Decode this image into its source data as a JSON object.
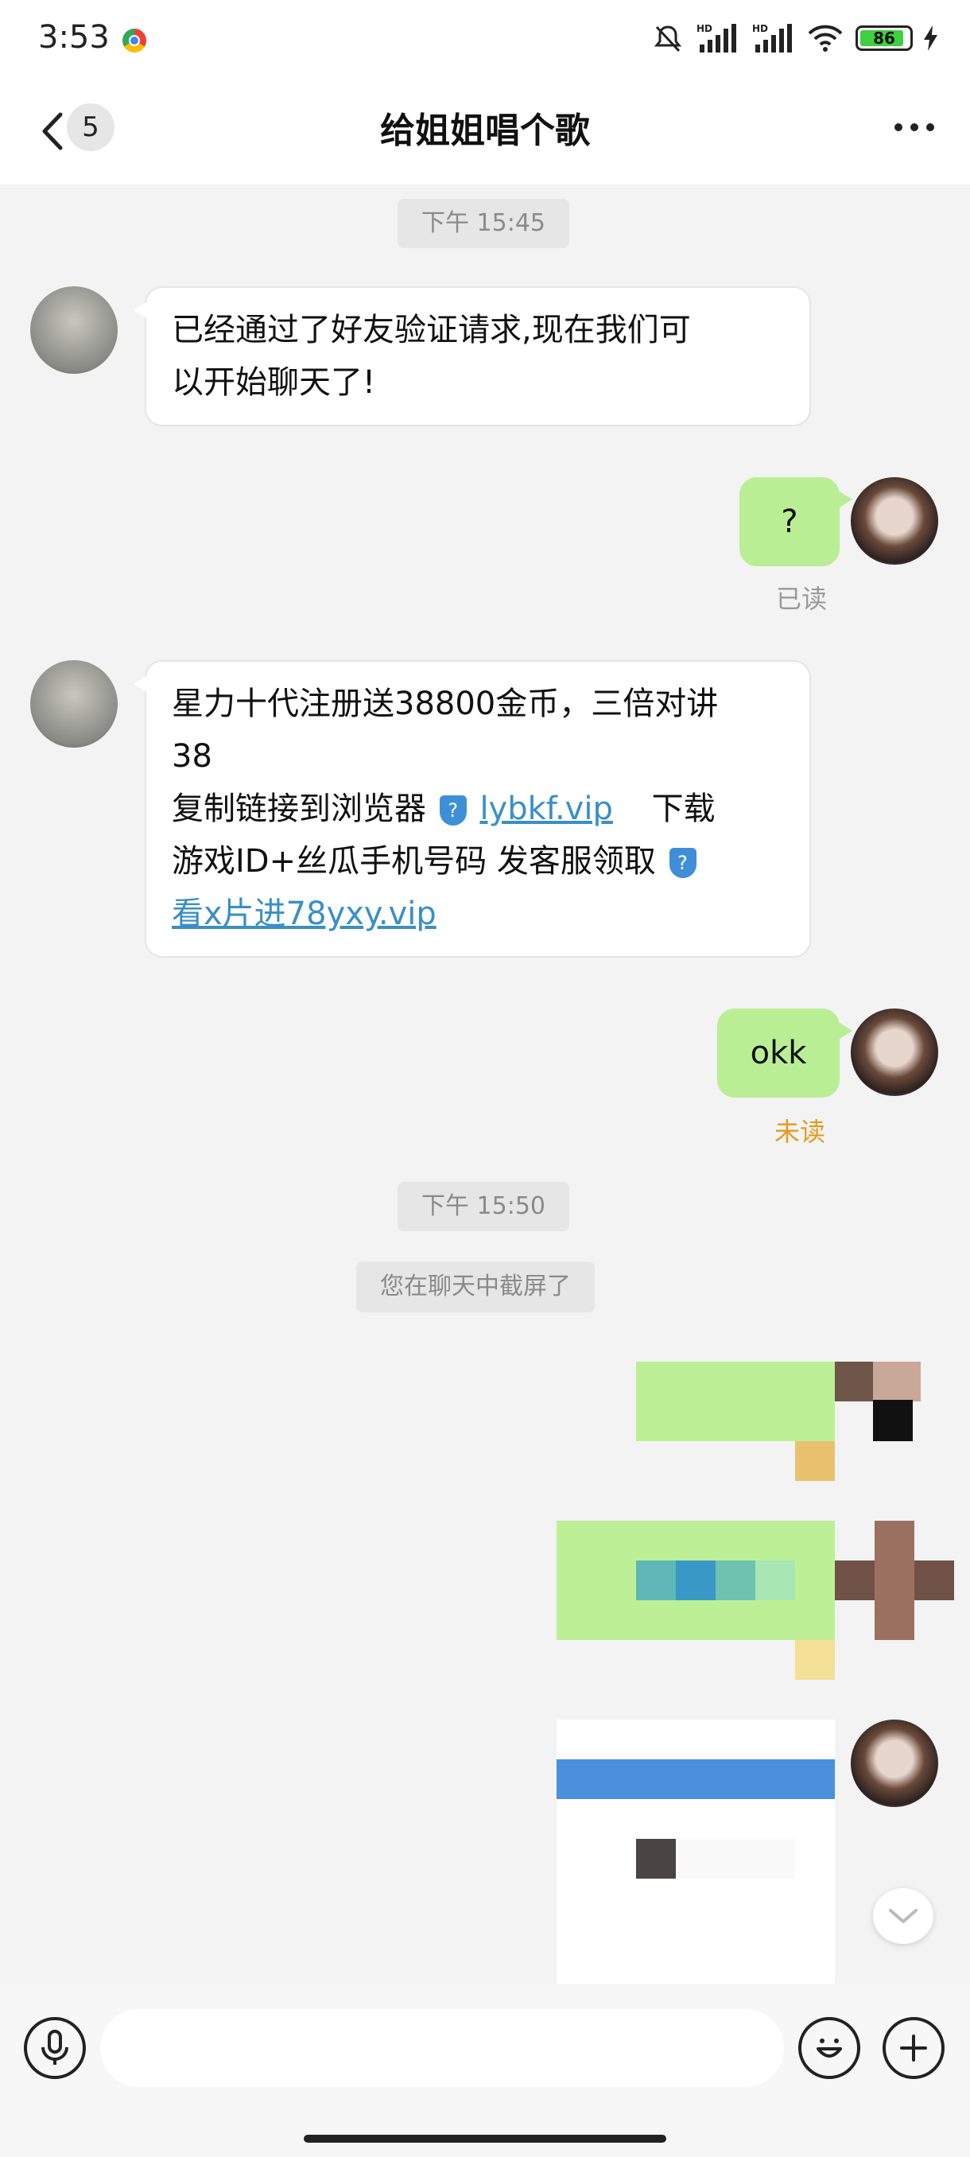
{
  "status_bar": {
    "time": "3:53",
    "battery_level": "86",
    "signal1": "HD",
    "signal2": "HD"
  },
  "nav": {
    "unread_count": "5",
    "title": "给姐姐唱个歌"
  },
  "messages": {
    "time1": "下午 15:45",
    "msg1_line1": "已经通过了好友验证请求,现在我们可",
    "msg1_line2": "以开始聊天了!",
    "msg2": "?",
    "msg2_status": "已读",
    "msg3_line1": "星力十代注册送38800金币，三倍对讲",
    "msg3_line2": "38",
    "msg3_line3_text": "复制链接到浏览器",
    "msg3_link1": "lybkf.vip",
    "msg3_line3_tail": "下载",
    "msg3_line4": "游戏ID+丝瓜手机号码 发客服领取",
    "msg3_link2": "看x片进78yxy.vip",
    "shield_glyph": "?",
    "msg4": "okk",
    "msg4_status": "未读",
    "time2": "下午 15:50",
    "system_notice": "您在聊天中截屏了"
  },
  "colors": {
    "bubble_out": "#b9ee95",
    "link": "#3a8fc6",
    "read": "#999999",
    "unread": "#e39b1f"
  },
  "input": {
    "placeholder": ""
  }
}
